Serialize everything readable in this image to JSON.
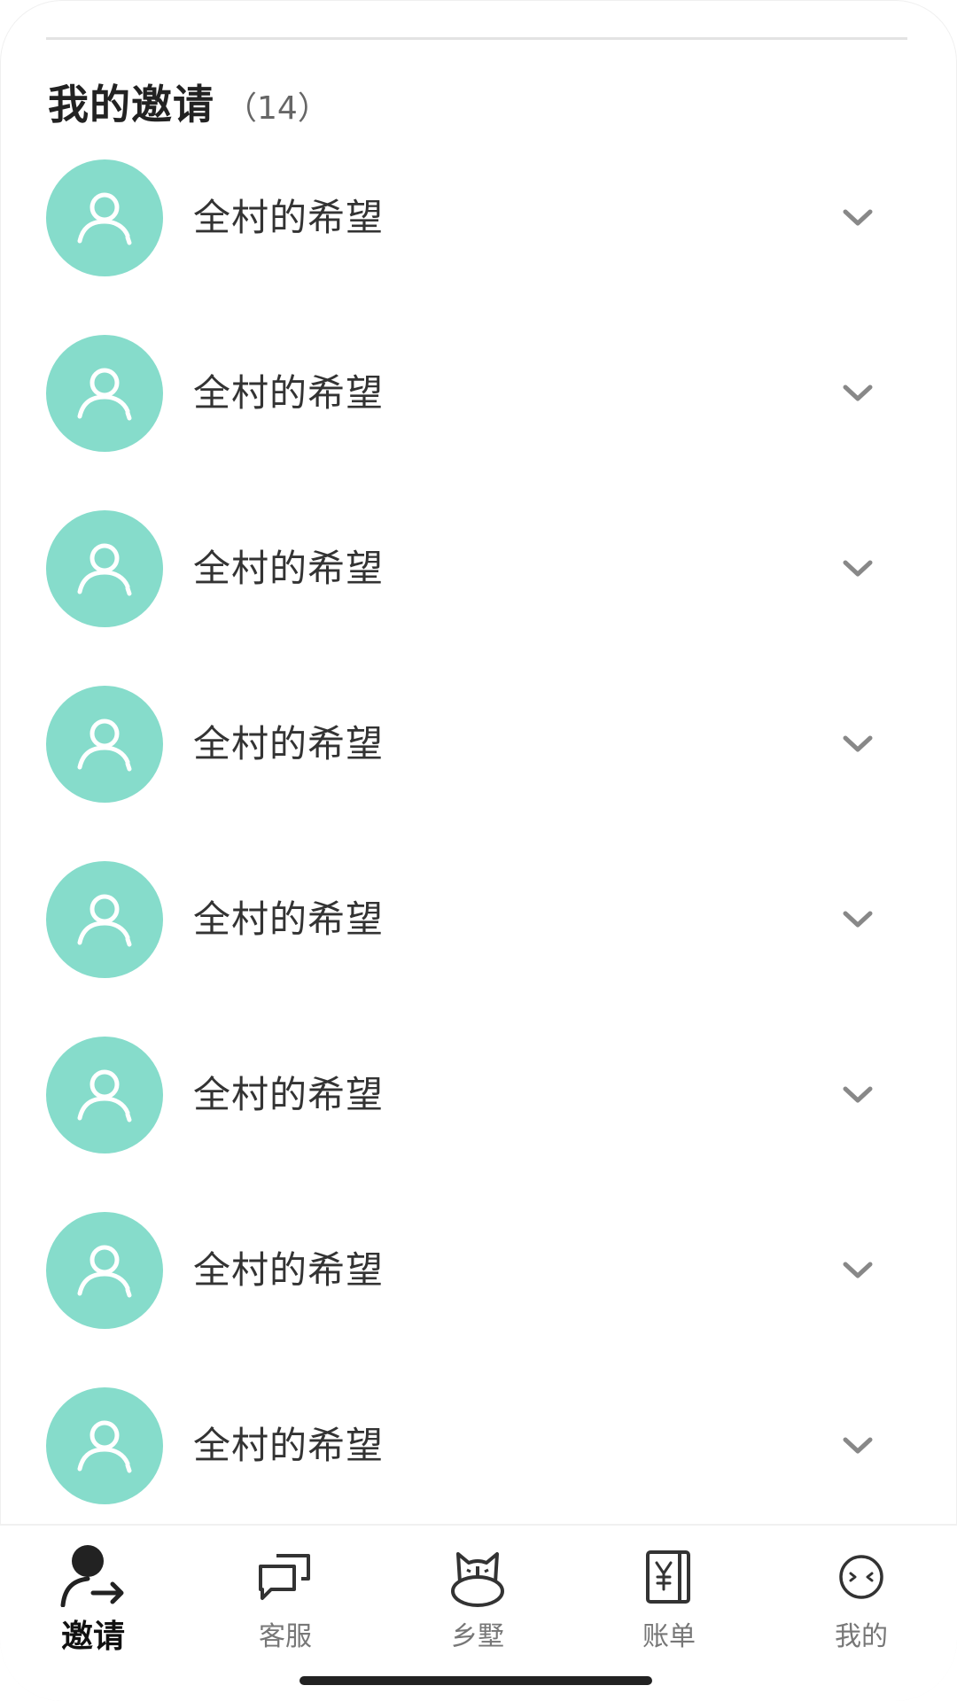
{
  "header": {
    "title": "我的邀请",
    "count": "（14）"
  },
  "invites": [
    {
      "name": "全村的希望"
    },
    {
      "name": "全村的希望"
    },
    {
      "name": "全村的希望"
    },
    {
      "name": "全村的希望"
    },
    {
      "name": "全村的希望"
    },
    {
      "name": "全村的希望"
    },
    {
      "name": "全村的希望"
    },
    {
      "name": "全村的希望"
    }
  ],
  "tabs": [
    {
      "label": "邀请",
      "icon": "invite-icon",
      "active": true
    },
    {
      "label": "客服",
      "icon": "chat-icon",
      "active": false
    },
    {
      "label": "乡墅",
      "icon": "villa-icon",
      "active": false
    },
    {
      "label": "账单",
      "icon": "bill-icon",
      "active": false
    },
    {
      "label": "我的",
      "icon": "profile-icon",
      "active": false
    }
  ],
  "colors": {
    "avatar_bg": "#86dccb",
    "text_primary": "#222222",
    "text_secondary": "#777777",
    "divider": "#e3e3e3"
  }
}
